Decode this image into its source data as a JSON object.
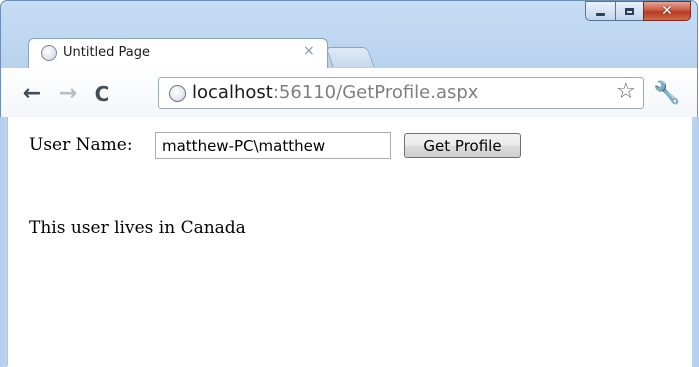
{
  "window": {
    "controls": {
      "minimize": "minimize-icon",
      "maximize": "maximize-icon",
      "close": "close-icon"
    }
  },
  "tab": {
    "title": "Untitled Page",
    "close_glyph": "×",
    "favicon": "globe-icon"
  },
  "toolbar": {
    "back_glyph": "←",
    "forward_glyph": "→",
    "reload_glyph": "C",
    "url_host": "localhost",
    "url_rest": ":56110/GetProfile.aspx",
    "star_glyph": "☆",
    "wrench_glyph": "🔧"
  },
  "page": {
    "user_label": "User Name:",
    "user_value": "matthew-PC\\matthew",
    "button_label": "Get Profile",
    "result_text": "This user lives in Canada"
  },
  "colors": {
    "frame": "#bcd5f0",
    "close_button": "#c95a43",
    "url_rest": "#7f7f7f"
  }
}
